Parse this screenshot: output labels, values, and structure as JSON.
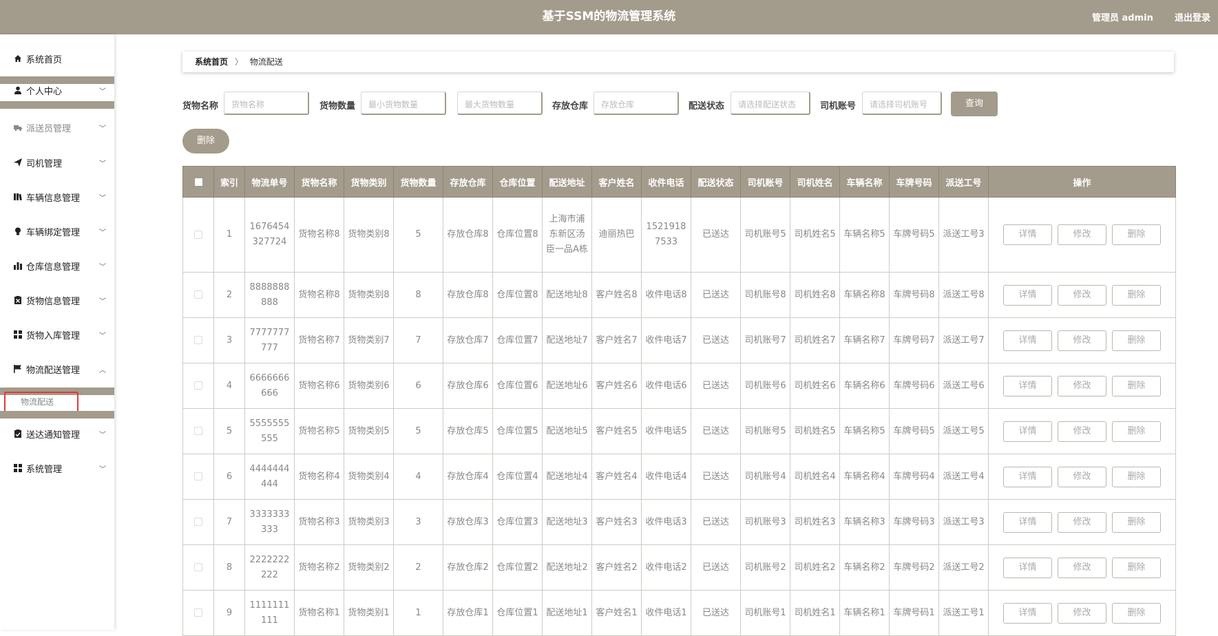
{
  "header": {
    "title": "基于SSM的物流管理系统",
    "admin": "管理员 admin",
    "logout": "退出登录"
  },
  "sidebar": {
    "items": [
      {
        "label": "系统首页",
        "icon": "home-icon"
      },
      {
        "label": "个人中心",
        "icon": "user-icon"
      },
      {
        "label": "派送员管理",
        "icon": "truck-icon"
      },
      {
        "label": "司机管理",
        "icon": "send-icon"
      },
      {
        "label": "车辆信息管理",
        "icon": "book-icon"
      },
      {
        "label": "车辆绑定管理",
        "icon": "bulb-icon"
      },
      {
        "label": "仓库信息管理",
        "icon": "bar-chart-icon"
      },
      {
        "label": "货物信息管理",
        "icon": "clipboard-icon"
      },
      {
        "label": "货物入库管理",
        "icon": "grid-icon"
      },
      {
        "label": "物流配送管理",
        "icon": "flag-icon"
      },
      {
        "label": "送达通知管理",
        "icon": "clipboard-check-icon"
      },
      {
        "label": "系统管理",
        "icon": "grid-icon"
      }
    ],
    "sub_item": "物流配送"
  },
  "breadcrumb": {
    "home": "系统首页",
    "sep": "〉",
    "current": "物流配送"
  },
  "search": {
    "goods_name_label": "货物名称",
    "goods_name_placeholder": "货物名称",
    "goods_qty_label": "货物数量",
    "min_qty_placeholder": "最小货物数量",
    "max_qty_placeholder": "最大货物数量",
    "warehouse_label": "存放仓库",
    "warehouse_placeholder": "存放仓库",
    "status_label": "配送状态",
    "status_placeholder": "请选择配送状态",
    "driver_label": "司机账号",
    "driver_placeholder": "请选择司机账号",
    "query_button": "查询"
  },
  "delete_button": "删除",
  "table": {
    "columns": [
      "索引",
      "物流单号",
      "货物名称",
      "货物类别",
      "货物数量",
      "存放仓库",
      "仓库位置",
      "配送地址",
      "客户姓名",
      "收件电话",
      "配送状态",
      "司机账号",
      "司机姓名",
      "车辆名称",
      "车牌号码",
      "派送工号",
      "操作"
    ],
    "actions": {
      "detail": "详情",
      "edit": "修改",
      "delete": "删除"
    },
    "rows": [
      [
        "1",
        "1676454327724",
        "货物名称8",
        "货物类别8",
        "5",
        "存放仓库8",
        "仓库位置8",
        "上海市浦东新区汤臣一品A栋",
        "迪丽热巴",
        "15219187533",
        "已送达",
        "司机账号5",
        "司机姓名5",
        "车辆名称5",
        "车牌号码5",
        "派送工号3"
      ],
      [
        "2",
        "8888888888",
        "货物名称8",
        "货物类别8",
        "8",
        "存放仓库8",
        "仓库位置8",
        "配送地址8",
        "客户姓名8",
        "收件电话8",
        "已送达",
        "司机账号8",
        "司机姓名8",
        "车辆名称8",
        "车牌号码8",
        "派送工号8"
      ],
      [
        "3",
        "7777777777",
        "货物名称7",
        "货物类别7",
        "7",
        "存放仓库7",
        "仓库位置7",
        "配送地址7",
        "客户姓名7",
        "收件电话7",
        "已送达",
        "司机账号7",
        "司机姓名7",
        "车辆名称7",
        "车牌号码7",
        "派送工号7"
      ],
      [
        "4",
        "6666666666",
        "货物名称6",
        "货物类别6",
        "6",
        "存放仓库6",
        "仓库位置6",
        "配送地址6",
        "客户姓名6",
        "收件电话6",
        "已送达",
        "司机账号6",
        "司机姓名6",
        "车辆名称6",
        "车牌号码6",
        "派送工号6"
      ],
      [
        "5",
        "5555555555",
        "货物名称5",
        "货物类别5",
        "5",
        "存放仓库5",
        "仓库位置5",
        "配送地址5",
        "客户姓名5",
        "收件电话5",
        "已送达",
        "司机账号5",
        "司机姓名5",
        "车辆名称5",
        "车牌号码5",
        "派送工号5"
      ],
      [
        "6",
        "4444444444",
        "货物名称4",
        "货物类别4",
        "4",
        "存放仓库4",
        "仓库位置4",
        "配送地址4",
        "客户姓名4",
        "收件电话4",
        "已送达",
        "司机账号4",
        "司机姓名4",
        "车辆名称4",
        "车牌号码4",
        "派送工号4"
      ],
      [
        "7",
        "3333333333",
        "货物名称3",
        "货物类别3",
        "3",
        "存放仓库3",
        "仓库位置3",
        "配送地址3",
        "客户姓名3",
        "收件电话3",
        "已送达",
        "司机账号3",
        "司机姓名3",
        "车辆名称3",
        "车牌号码3",
        "派送工号3"
      ],
      [
        "8",
        "2222222222",
        "货物名称2",
        "货物类别2",
        "2",
        "存放仓库2",
        "仓库位置2",
        "配送地址2",
        "客户姓名2",
        "收件电话2",
        "已送达",
        "司机账号2",
        "司机姓名2",
        "车辆名称2",
        "车牌号码2",
        "派送工号2"
      ],
      [
        "9",
        "1111111111",
        "货物名称1",
        "货物类别1",
        "1",
        "存放仓库1",
        "仓库位置1",
        "配送地址1",
        "客户姓名1",
        "收件电话1",
        "已送达",
        "司机账号1",
        "司机姓名1",
        "车辆名称1",
        "车牌号码1",
        "派送工号1"
      ]
    ]
  },
  "colors": {
    "accent": "#a39b8b",
    "highlight_border": "#e23a3a"
  }
}
